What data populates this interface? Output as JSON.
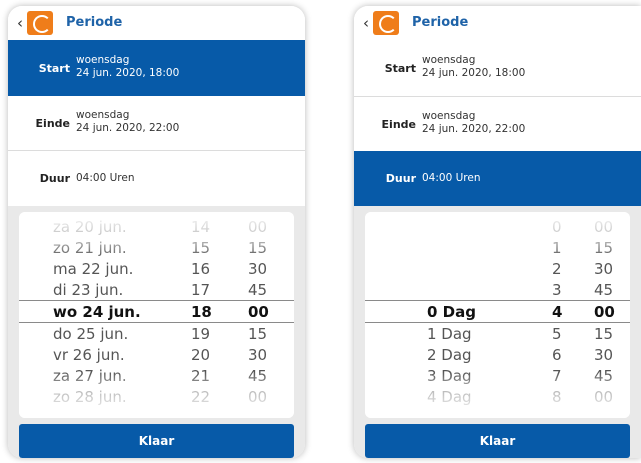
{
  "screens": [
    {
      "header": {
        "back_icon": "‹",
        "logo": "brand-logo-icon",
        "title": "Periode"
      },
      "start": {
        "label": "Start",
        "day": "woensdag",
        "datetime": "24 jun. 2020, 18:00"
      },
      "end": {
        "label": "Einde",
        "day": "woensdag",
        "datetime": "24 jun. 2020, 22:00"
      },
      "duration": {
        "label": "Duur",
        "value": "04:00 Uren"
      },
      "picker": {
        "dates": [
          "za 20 jun.",
          "zo 21 jun.",
          "ma 22 jun.",
          "di 23 jun.",
          "wo 24 jun.",
          "do 25 jun.",
          "vr 26 jun.",
          "za 27 jun.",
          "zo 28 jun."
        ],
        "hours": [
          "14",
          "15",
          "16",
          "17",
          "18",
          "19",
          "20",
          "21",
          "22"
        ],
        "minutes": [
          "00",
          "15",
          "30",
          "45",
          "00",
          "15",
          "30",
          "45",
          "00"
        ]
      },
      "done_label": "Klaar"
    },
    {
      "header": {
        "back_icon": "‹",
        "logo": "brand-logo-icon",
        "title": "Periode"
      },
      "start": {
        "label": "Start",
        "day": "woensdag",
        "datetime": "24 jun. 2020, 18:00"
      },
      "end": {
        "label": "Einde",
        "day": "woensdag",
        "datetime": "24 jun. 2020, 22:00"
      },
      "duration": {
        "label": "Duur",
        "value": "04:00 Uren"
      },
      "picker": {
        "days": [
          "0 Dag",
          "1 Dag",
          "2 Dag",
          "3 Dag",
          "4 Dag"
        ],
        "hours": [
          "0",
          "1",
          "2",
          "3",
          "4",
          "5",
          "6",
          "7",
          "8"
        ],
        "minutes": [
          "00",
          "15",
          "30",
          "45",
          "00",
          "15",
          "30",
          "45",
          "00"
        ]
      },
      "done_label": "Klaar"
    }
  ]
}
